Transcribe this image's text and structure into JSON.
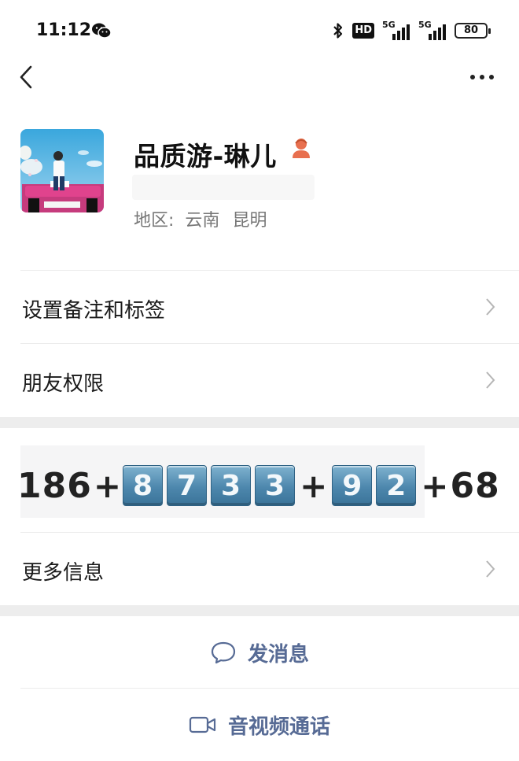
{
  "status_bar": {
    "time": "11:12",
    "hd": "HD",
    "network_1": "5G",
    "network_2": "5G",
    "battery": "80"
  },
  "profile": {
    "name": "品质游-琳儿",
    "region_label": "地区:",
    "region_province": "云南",
    "region_city": "昆明"
  },
  "rows": {
    "remark": "设置备注和标签",
    "permission": "朋友权限",
    "more_info": "更多信息"
  },
  "phone": {
    "prefix": "186",
    "group1": [
      "8",
      "7",
      "3",
      "3"
    ],
    "group2": [
      "9",
      "2"
    ],
    "suffix": "68",
    "separator": "+"
  },
  "actions": {
    "message": "发消息",
    "call": "音视频通话"
  },
  "colors": {
    "link_blue": "#576b95",
    "separator_band": "#ededed",
    "gender_female": "#e8704f",
    "keycap_blue": "#4d87ad"
  }
}
